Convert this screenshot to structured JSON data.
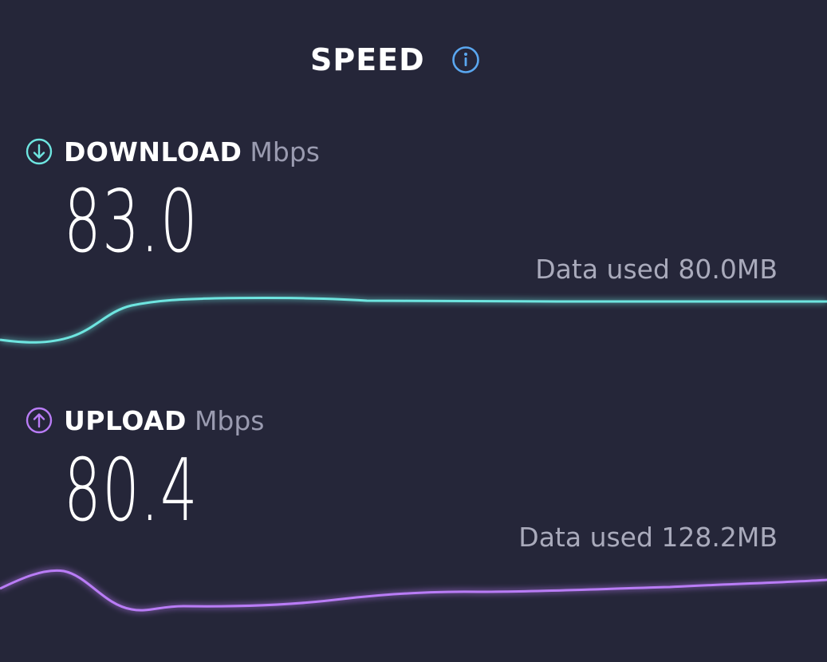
{
  "header": {
    "title": "SPEED",
    "info_icon": "info-circle-icon"
  },
  "colors": {
    "background": "#252639",
    "download_accent": "#6ee5e0",
    "upload_accent": "#b97cf6",
    "info_accent": "#5aa7f0"
  },
  "download": {
    "label": "DOWNLOAD",
    "unit": "Mbps",
    "value": "83.0",
    "data_used": "Data used 80.0MB",
    "icon": "arrow-down-circle-icon"
  },
  "upload": {
    "label": "UPLOAD",
    "unit": "Mbps",
    "value": "80.4",
    "data_used": "Data used 128.2MB",
    "icon": "arrow-up-circle-icon"
  }
}
